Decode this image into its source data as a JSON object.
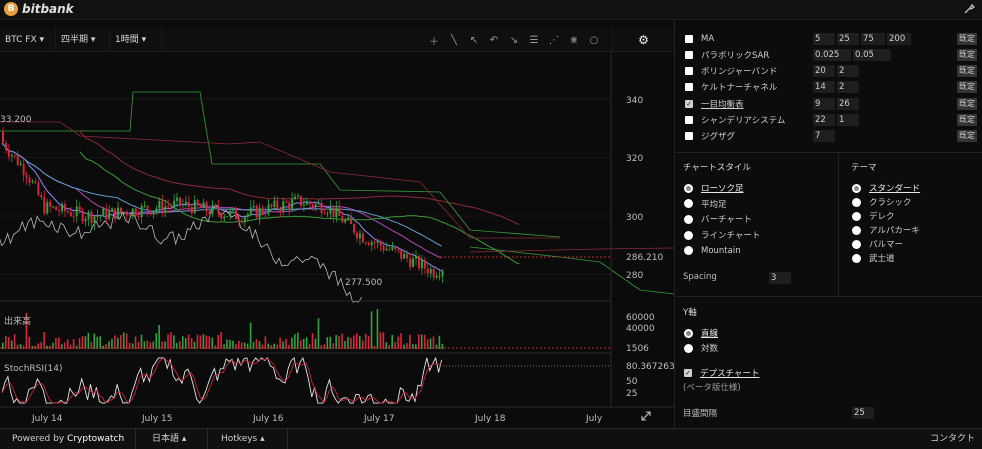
{
  "app": {
    "brand": "bitbank",
    "brand_mark": "B"
  },
  "toolbar": {
    "pair": "BTC FX",
    "period": "四半期",
    "interval": "1時間",
    "caret": "▾"
  },
  "chart": {
    "price_labels": [
      "340",
      "320",
      "300",
      "286.210",
      "280"
    ],
    "high_label": "33.200",
    "low_label": "277.500",
    "volume_label": "出来高",
    "volume_ticks": [
      "60000",
      "40000",
      "1506"
    ],
    "stoch_label": "StochRSI(14)",
    "stoch_ticks": [
      "80.367263",
      "50",
      "25"
    ],
    "x_labels": [
      "July 14",
      "July 15",
      "July 16",
      "July 17",
      "July 18",
      "July"
    ],
    "colors": {
      "up": "#2fa53a",
      "down": "#d7263d",
      "ma1": "#8a8aff",
      "ma2": "#b04bb0",
      "ma3": "#5fa0d0",
      "cloud": "#3c9a3c",
      "band": "#8a2a3a"
    }
  },
  "indicators": [
    {
      "label": "MA",
      "checked": false,
      "values": [
        "5",
        "25",
        "75",
        "200"
      ],
      "default": "既定"
    },
    {
      "label": "パラボリックSAR",
      "checked": false,
      "values": [
        "0.025",
        "0.05"
      ],
      "default": "既定"
    },
    {
      "label": "ボリンジャーバンド",
      "checked": false,
      "values": [
        "20",
        "2"
      ],
      "default": "既定"
    },
    {
      "label": "ケルトナーチャネル",
      "checked": false,
      "values": [
        "14",
        "2"
      ],
      "default": "既定"
    },
    {
      "label": "一目均衡表",
      "checked": true,
      "values": [
        "9",
        "26"
      ],
      "default": "既定"
    },
    {
      "label": "シャンデリアシステム",
      "checked": false,
      "values": [
        "22",
        "1"
      ],
      "default": "既定"
    },
    {
      "label": "ジグザグ",
      "checked": false,
      "values": [
        "7"
      ],
      "default": "既定"
    }
  ],
  "chart_style": {
    "title": "チャートスタイル",
    "options": [
      "ローソク足",
      "平均足",
      "バーチャート",
      "ラインチャート",
      "Mountain"
    ],
    "selected": 0,
    "spacing_label": "Spacing",
    "spacing_value": "3"
  },
  "theme": {
    "title": "テーマ",
    "options": [
      "スタンダード",
      "クラシック",
      "デレク",
      "アルパカーキ",
      "パルマー",
      "武士道"
    ],
    "selected": 0
  },
  "y_axis": {
    "title": "Y軸",
    "options": [
      "直線",
      "対数"
    ],
    "selected": 0,
    "depth_label": "デプスチャート",
    "depth_note": "(ベータ版仕様)",
    "depth_checked": true,
    "grid_label": "目盛間隔",
    "grid_value": "25"
  },
  "bottom": {
    "powered": "Powered by",
    "powered_brand": "Cryptowatch",
    "language": "日本語",
    "hotkeys": "Hotkeys",
    "contact": "コンタクト",
    "up_caret": "▴"
  }
}
